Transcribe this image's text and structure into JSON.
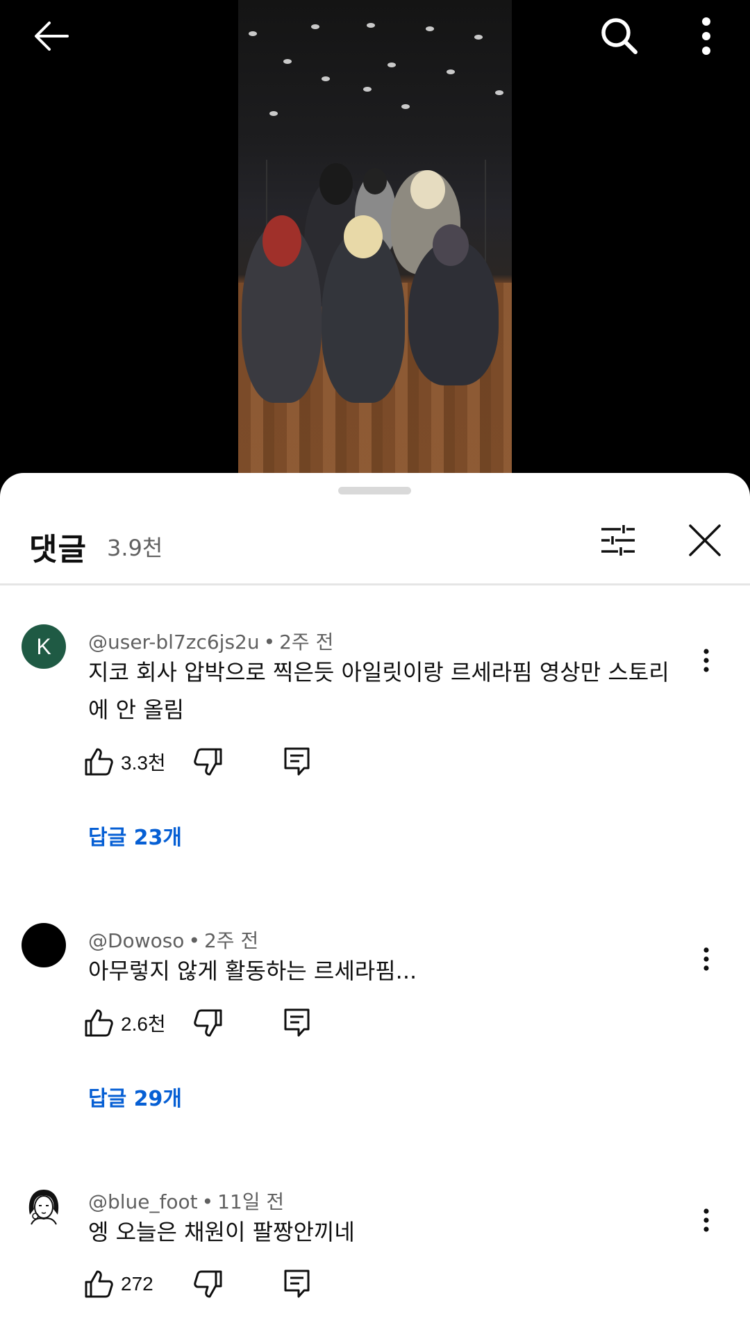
{
  "colors": {
    "accent": "#065fd4",
    "secondary_text": "#606060",
    "sheet_bg": "#ffffff",
    "video_bg": "#000000"
  },
  "top_bar": {
    "back_icon": "arrow-left-icon",
    "search_icon": "search-icon",
    "more_icon": "more-vert-icon"
  },
  "comments_panel": {
    "title": "댓글",
    "count": "3.9천",
    "filter_icon": "sort-filter-icon",
    "close_icon": "close-icon"
  },
  "comments": [
    {
      "author": "@user-bl7zc6js2u",
      "time": "2주 전",
      "avatar_letter": "K",
      "avatar_color": "#1f5a44",
      "text": "지코 회사 압박으로 찍은듯 아일릿이랑 르세라핌 영상만 스토리에 안 올림",
      "likes": "3.3천",
      "replies_label": "답글 23개"
    },
    {
      "author": "@Dowoso",
      "time": "2주 전",
      "avatar_letter": "",
      "avatar_color": "#000000",
      "text": "아무렇지 않게 활동하는 르세라핌...",
      "likes": "2.6천",
      "replies_label": "답글 29개"
    },
    {
      "author": "@blue_foot",
      "time": "11일 전",
      "avatar_letter": "",
      "avatar_color": "#ffffff",
      "text": "엥 오늘은 채원이 팔짱안끼네",
      "likes": "272"
    }
  ]
}
